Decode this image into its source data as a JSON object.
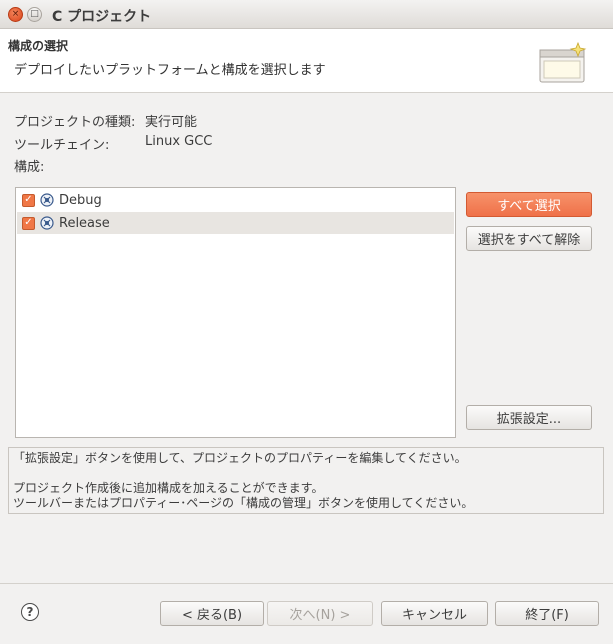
{
  "window": {
    "title": "C プロジェクト",
    "close_glyph": "×",
    "minimize_glyph": "□"
  },
  "header": {
    "title": "構成の選択",
    "description": "デプロイしたいプラットフォームと構成を選択します",
    "icon": "wizard-banner-icon"
  },
  "info": {
    "project_type_label": "プロジェクトの種類:",
    "project_type_value": "実行可能",
    "toolchain_label": "ツールチェイン:",
    "toolchain_value": "Linux GCC",
    "configs_label": "構成:"
  },
  "configurations": [
    {
      "label": "Debug",
      "checked": true,
      "icon": "build-config-icon"
    },
    {
      "label": "Release",
      "checked": true,
      "icon": "build-config-icon"
    }
  ],
  "side_buttons": {
    "select_all": "すべて選択",
    "deselect_all": "選択をすべて解除",
    "advanced": "拡張設定..."
  },
  "note": {
    "line1": "「拡張設定」ボタンを使用して、プロジェクトのプロパティーを編集してください。",
    "line2": "プロジェクト作成後に追加構成を加えることができます。",
    "line3": "ツールバーまたはプロパティー･ページの「構成の管理」ボタンを使用してください。"
  },
  "footer": {
    "help": "?",
    "back": "< 戻る(B)",
    "next": "次へ(N) >",
    "cancel": "キャンセル",
    "finish": "終了(F)"
  },
  "colors": {
    "accent": "#ef7149",
    "checkbox": "#f07746"
  }
}
